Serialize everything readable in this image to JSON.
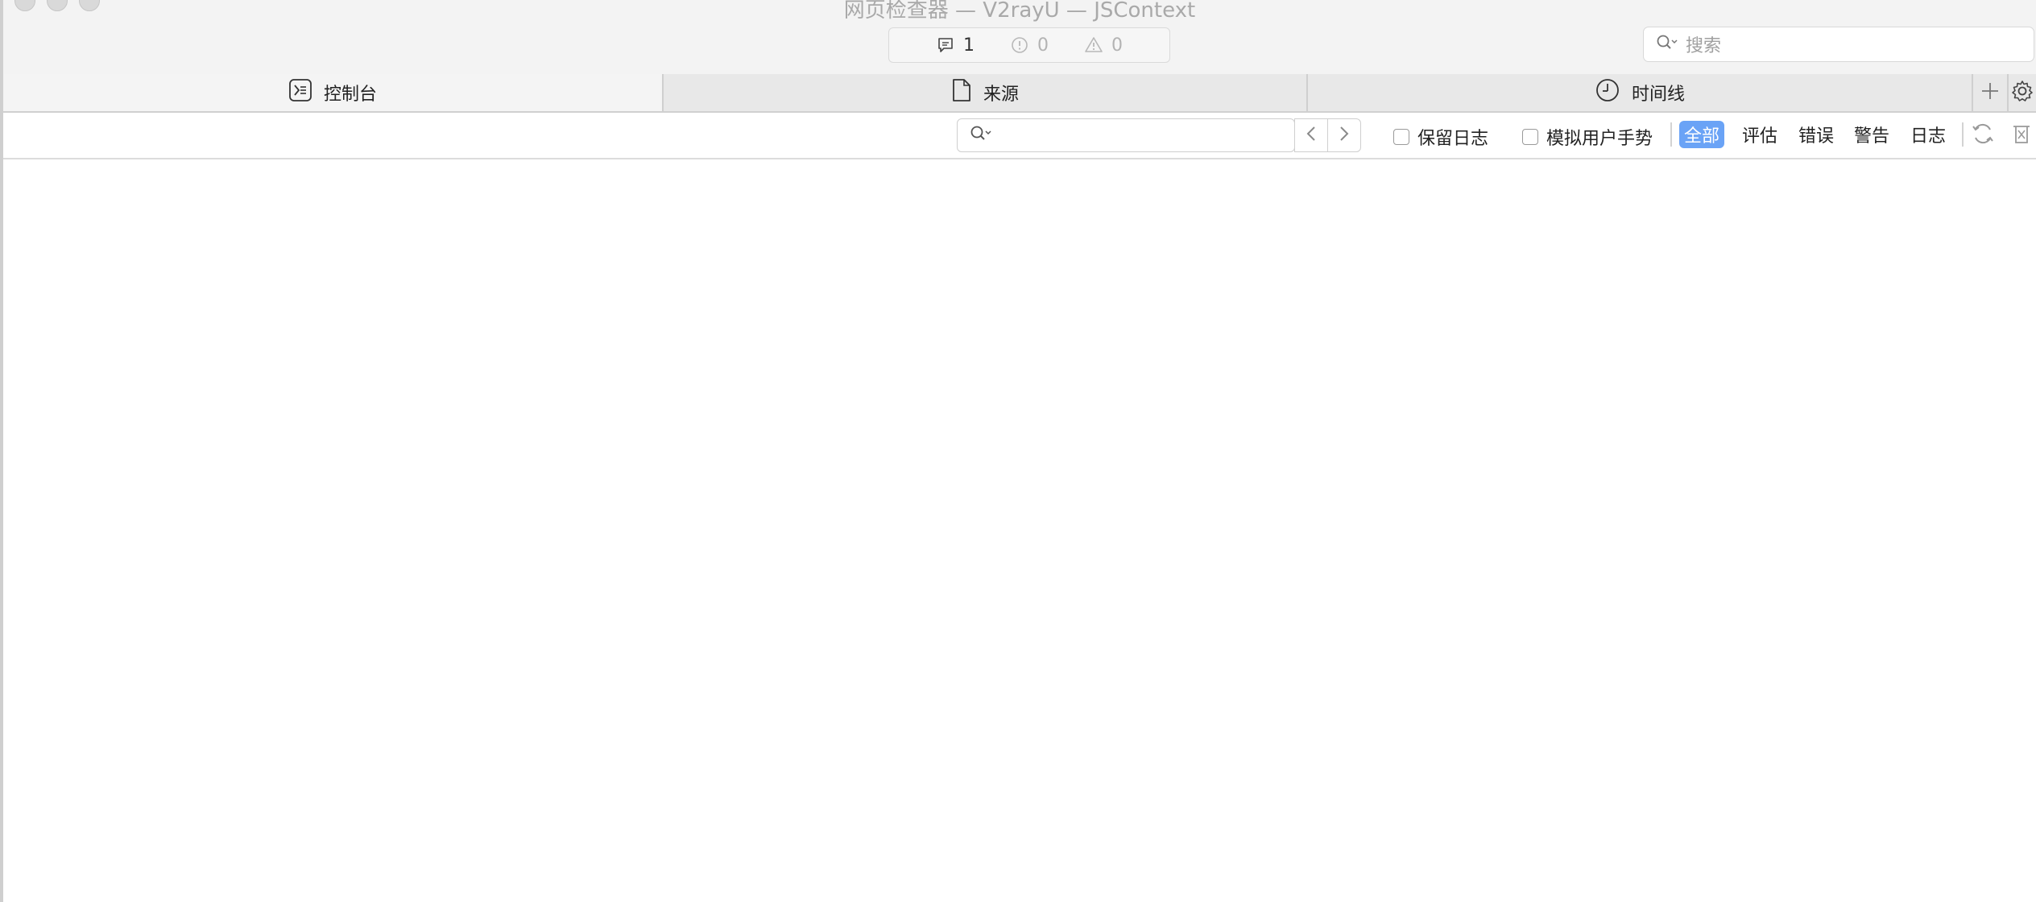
{
  "window": {
    "title": "网页检查器 — V2rayU — JSContext"
  },
  "counters": {
    "messages": "1",
    "errors": "0",
    "warnings": "0"
  },
  "search": {
    "placeholder": "搜索"
  },
  "tabs": [
    {
      "label": "控制台",
      "icon": "console-icon",
      "active": true
    },
    {
      "label": "来源",
      "icon": "document-icon",
      "active": false
    },
    {
      "label": "时间线",
      "icon": "clock-icon",
      "active": false
    }
  ],
  "toolbar": {
    "filter_value": "",
    "preserve_log_label": "保留日志",
    "emulate_gesture_label": "模拟用户手势",
    "levels": [
      {
        "label": "全部",
        "selected": true
      },
      {
        "label": "评估",
        "selected": false
      },
      {
        "label": "错误",
        "selected": false
      },
      {
        "label": "警告",
        "selected": false
      },
      {
        "label": "日志",
        "selected": false
      }
    ]
  },
  "colors": {
    "accent": "#6aa3f6",
    "titlebar_bg": "#f3f3f3",
    "tabbar_bg": "#e8e8e8"
  }
}
